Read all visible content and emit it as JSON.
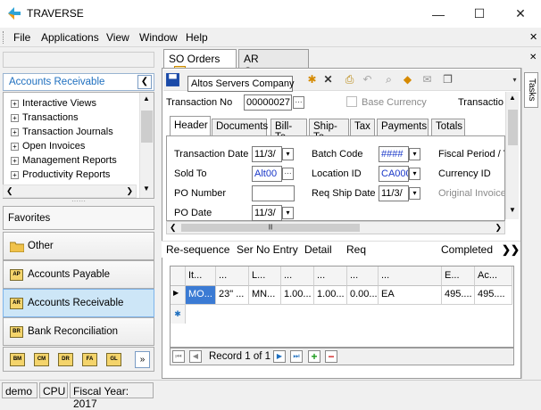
{
  "window": {
    "title": "TRAVERSE",
    "minimize": "—",
    "maximize": "☐",
    "close": "✕"
  },
  "menu": [
    "File",
    "Applications",
    "View",
    "Window",
    "Help"
  ],
  "left": {
    "nav_title": "Accounts Receivable",
    "tree": [
      "Interactive Views",
      "Transactions",
      "Transaction Journals",
      "Open Invoices",
      "Management Reports",
      "Productivity Reports"
    ],
    "favorites_title": "Favorites",
    "fav_items": [
      {
        "label": "Other",
        "icon": "folder-icon"
      },
      {
        "label": "Accounts Payable",
        "icon": "AP"
      },
      {
        "label": "Accounts Receivable",
        "icon": "AR",
        "selected": true
      },
      {
        "label": "Bank Reconciliation",
        "icon": "BR"
      }
    ],
    "small_icons": [
      "BM",
      "CM",
      "DR",
      "FA",
      "GL"
    ]
  },
  "doc_tabs": [
    "SO Orders",
    "AR Customers"
  ],
  "tooltip": "Altos Servers Company",
  "form": {
    "transaction_no_label": "Transaction No",
    "transaction_no": "00000027",
    "base_currency_label": "Base Currency",
    "transaction_cut": "Transactio",
    "tabs": [
      "Header",
      "Documents",
      "Bill-To",
      "Ship-To",
      "Tax",
      "Payments",
      "Totals"
    ],
    "fields": {
      "transaction_date_label": "Transaction Date",
      "transaction_date": "11/3/",
      "sold_to_label": "Sold To",
      "sold_to": "Alt00",
      "po_number_label": "PO Number",
      "po_number": "",
      "po_date_label": "PO Date",
      "po_date": "11/3/",
      "batch_code_label": "Batch Code",
      "batch_code": "####",
      "location_id_label": "Location ID",
      "location_id": "CA000",
      "req_ship_date_label": "Req Ship Date",
      "req_ship_date": "11/3/",
      "fiscal_period_label": "Fiscal Period / Y",
      "currency_id_label": "Currency ID",
      "original_invoice_label": "Original Invoice"
    }
  },
  "actions": {
    "resequence": "Re-sequence",
    "ser_no": "Ser No Entry",
    "detail": "Detail",
    "req": "Req",
    "completed": "Completed",
    "more": "❯❯"
  },
  "grid": {
    "headers": [
      "It...",
      "...",
      "L...",
      "...",
      "...",
      "...",
      "...",
      "E...",
      "Ac..."
    ],
    "row": [
      "MO...",
      "23\" ...",
      "MN...",
      "1.00...",
      "1.00...",
      "0.00...",
      "EA",
      "495....",
      "495...."
    ],
    "new_row_marker": "✱"
  },
  "record_nav": {
    "text": "Record 1 of 1"
  },
  "tasks_label": "Tasks",
  "status": [
    "demo",
    "CPU",
    "Fiscal Year: 2017"
  ],
  "colors": {
    "accent": "#1e6fbf",
    "selection": "#3b7bd4",
    "fav_selected": "#cde6f7"
  }
}
